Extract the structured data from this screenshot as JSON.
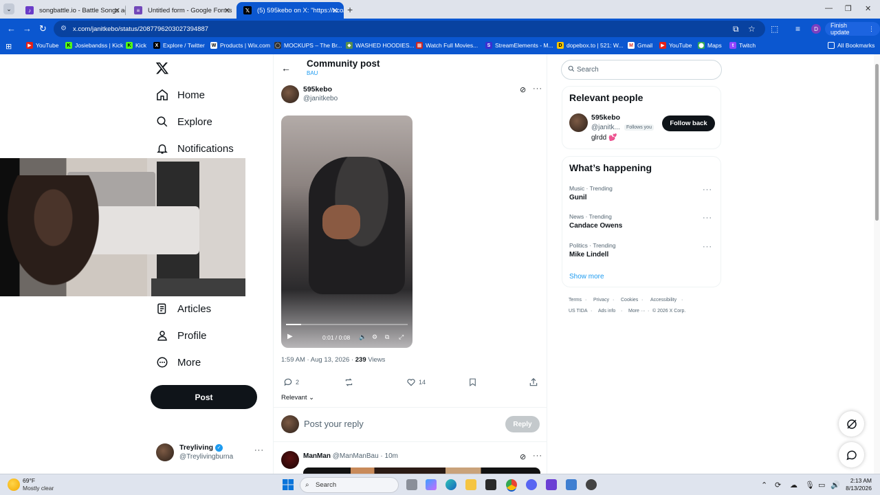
{
  "browser": {
    "tabs": [
      {
        "title": "songbattle.io - Battle Songs ag",
        "active": false
      },
      {
        "title": "Untitled form - Google Forms",
        "active": false
      },
      {
        "title": "(5) 595kebo on X: \"https://t.co/",
        "active": true
      }
    ],
    "url": "x.com/janitkebo/status/2087796203027394887",
    "finish_update": "Finish update",
    "profile_initial": "D",
    "bookmarks": [
      "YouTube",
      "Josiebandss | Kick",
      "Kick",
      "Explore / Twitter",
      "Products | Wix.com",
      "MOCKUPS – The Br...",
      "WASHED HOODIES...",
      "Watch Full Movies...",
      "StreamElements - M...",
      "dopebox.to | 521: W...",
      "Gmail",
      "YouTube",
      "Maps",
      "Twitch"
    ],
    "all_bookmarks": "All Bookmarks"
  },
  "sidebar": {
    "items": [
      {
        "label": "Home",
        "icon": "home-icon"
      },
      {
        "label": "Explore",
        "icon": "search-icon"
      },
      {
        "label": "Notifications",
        "icon": "bell-icon"
      },
      {
        "label": "Articles",
        "icon": "articles-icon"
      },
      {
        "label": "Profile",
        "icon": "profile-icon"
      },
      {
        "label": "More",
        "icon": "more-circle-icon"
      }
    ],
    "post_button": "Post",
    "account": {
      "name": "Treyliving",
      "handle": "@Treylivingburna"
    }
  },
  "main": {
    "header_title": "Community post",
    "header_sub": "BAU",
    "author": {
      "name": "595kebo",
      "handle": "@janitkebo"
    },
    "video": {
      "time": "0:01 / 0:08",
      "progress": 0.125
    },
    "timestamp": "1:59 AM · Aug 13, 2026 · ",
    "views_count": "239",
    "views_label": " Views",
    "replies": "2",
    "likes": "14",
    "sort": "Relevant",
    "reply_placeholder": "Post your reply",
    "reply_button": "Reply",
    "reply_post": {
      "name": "ManMan",
      "handle": "@ManManBau",
      "time": "· 10m"
    }
  },
  "right": {
    "search_placeholder": "Search",
    "relevant_title": "Relevant people",
    "person": {
      "name": "595kebo",
      "handle": "@janitk...",
      "follows_you": "Follows you",
      "bio": "glrdd 💕",
      "follow_button": "Follow back"
    },
    "happening_title": "What’s happening",
    "trends": [
      {
        "meta": "Music · Trending",
        "name": "Gunil"
      },
      {
        "meta": "News · Trending",
        "name": "Candace Owens"
      },
      {
        "meta": "Politics · Trending",
        "name": "Mike Lindell"
      }
    ],
    "show_more": "Show more",
    "footer": [
      "Terms",
      "Privacy",
      "Cookies",
      "Accessibility",
      "US TIDA",
      "Ads info",
      "More ···",
      "© 2026 X Corp."
    ]
  },
  "taskbar": {
    "weather_temp": "69°F",
    "weather_desc": "Mostly clear",
    "search": "Search",
    "time": "2:13 AM",
    "date": "8/13/2026"
  },
  "colors": {
    "accent": "#0b57d0",
    "x_blue": "#1d9bf0",
    "text": "#0f1419",
    "muted": "#536471"
  }
}
